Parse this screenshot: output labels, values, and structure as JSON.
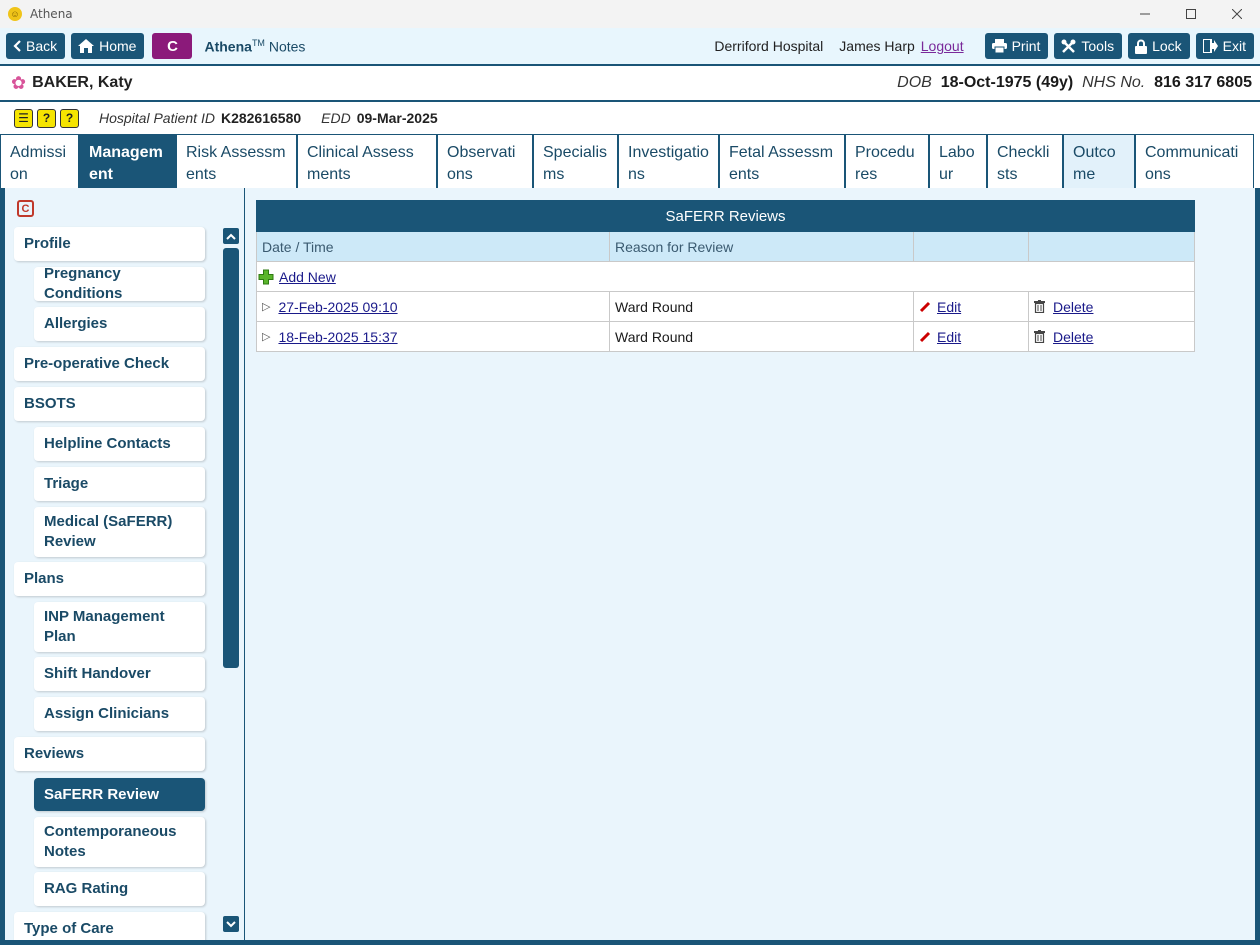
{
  "window": {
    "title": "Athena"
  },
  "toolbar": {
    "back": "Back",
    "home": "Home",
    "c_button": "C",
    "brand_name": "Athena",
    "brand_tm": "TM",
    "brand_suffix": "Notes",
    "hospital": "Derriford Hospital",
    "user": "James Harp",
    "logout": "Logout",
    "print": "Print",
    "tools": "Tools",
    "lock": "Lock",
    "exit": "Exit"
  },
  "patient": {
    "name": "BAKER, Katy",
    "dob_label": "DOB",
    "dob_value": "18-Oct-1975 (49y)",
    "nhs_label": "NHS No.",
    "nhs_value": "816 317 6805",
    "hospital_id_label": "Hospital Patient ID",
    "hospital_id_value": "K282616580",
    "edd_label": "EDD",
    "edd_value": "09-Mar-2025"
  },
  "tabs": [
    "Admission",
    "Management",
    "Risk Assessments",
    "Clinical Assessments",
    "Observations",
    "Specialisms",
    "Investigations",
    "Fetal Assessments",
    "Procedures",
    "Labour",
    "Checklists",
    "Outcome",
    "Communications"
  ],
  "sidebar": {
    "items": [
      "Profile",
      "Pregnancy Conditions",
      "Allergies",
      "Pre-operative Check",
      "BSOTS",
      "Helpline Contacts",
      "Triage",
      "Medical (SaFERR) Review",
      "Plans",
      "INP Management Plan",
      "Shift Handover",
      "Assign Clinicians",
      "Reviews",
      "SaFERR Review",
      "Contemporaneous Notes",
      "RAG Rating",
      "Type of Care"
    ]
  },
  "panel": {
    "title": "SaFERR Reviews",
    "columns": [
      "Date / Time",
      "Reason for Review",
      "",
      ""
    ],
    "add_new": "Add New",
    "rows": [
      {
        "datetime": "27-Feb-2025 09:10",
        "reason": "Ward Round",
        "edit": "Edit",
        "delete": "Delete"
      },
      {
        "datetime": "18-Feb-2025 15:37",
        "reason": "Ward Round",
        "edit": "Edit",
        "delete": "Delete"
      }
    ]
  }
}
